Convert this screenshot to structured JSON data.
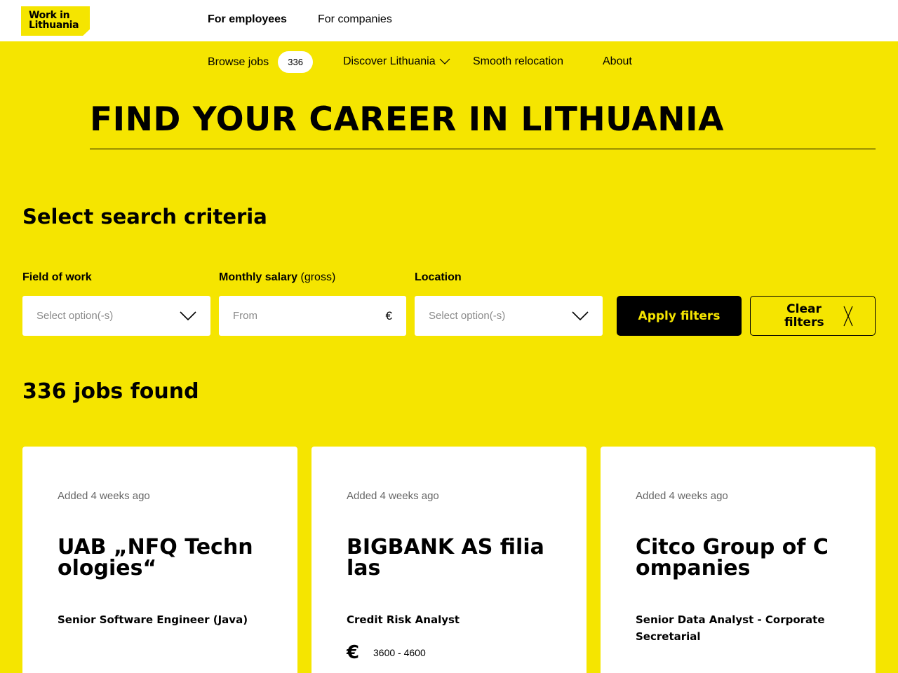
{
  "header": {
    "logo_line1": "Work in",
    "logo_line2": "Lithuania",
    "audience_tabs": [
      "For employees",
      "For companies"
    ]
  },
  "nav": {
    "browse_jobs": "Browse jobs",
    "jobs_badge": "336",
    "discover": "Discover Lithuania",
    "relocation": "Smooth relocation",
    "about": "About"
  },
  "hero": {
    "title": "FIND YOUR CAREER IN LITHUANIA"
  },
  "search": {
    "title": "Select search criteria",
    "field_label": "Field of work",
    "salary_label": "Monthly salary",
    "salary_label_note": "(gross)",
    "location_label": "Location",
    "field_placeholder": "Select option(-s)",
    "salary_placeholder": "From",
    "salary_currency": "€",
    "location_placeholder": "Select option(-s)",
    "apply": "Apply filters",
    "clear": "Clear filters"
  },
  "results": {
    "count_text": "336 jobs found",
    "cards": [
      {
        "added": "Added 4 weeks ago",
        "company": "UAB „NFQ Technologies“",
        "position": "Senior Software Engineer (Java)"
      },
      {
        "added": "Added 4 weeks ago",
        "company": "BIGBANK AS filialas",
        "position": "Credit Risk Analyst",
        "currency": "€",
        "salary": "3600 - 4600"
      },
      {
        "added": "Added 4 weeks ago",
        "company": "Citco Group of Companies",
        "position": "Senior Data Analyst - Corporate Secretarial"
      }
    ]
  },
  "colors": {
    "brand_yellow": "#f5e500",
    "black": "#000000",
    "white": "#ffffff"
  }
}
